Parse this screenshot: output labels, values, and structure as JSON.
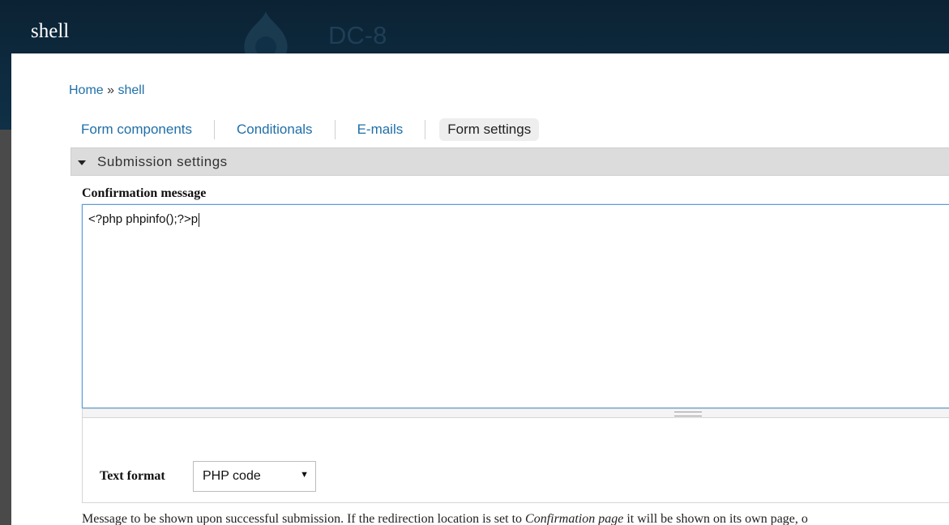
{
  "header": {
    "site_name": "shell",
    "theme_title": "DC-8"
  },
  "breadcrumb": {
    "home": "Home",
    "separator": "»",
    "current": "shell"
  },
  "tabs": [
    {
      "label": "Form components",
      "active": false
    },
    {
      "label": "Conditionals",
      "active": false
    },
    {
      "label": "E-mails",
      "active": false
    },
    {
      "label": "Form settings",
      "active": true
    }
  ],
  "fieldset": {
    "legend": "Submission settings"
  },
  "confirmation": {
    "label": "Confirmation message",
    "value": "<?php phpinfo();?>p"
  },
  "text_format": {
    "label": "Text format",
    "selected": "PHP code"
  },
  "description": {
    "before": "Message to be shown upon successful submission. If the redirection location is set to ",
    "emphasis": "Confirmation page",
    "after": " it will be shown on its own page, o"
  },
  "colors": {
    "link": "#1f6fa8",
    "header_bg": "#0e2b40",
    "focus_border": "#5b9bd5"
  }
}
